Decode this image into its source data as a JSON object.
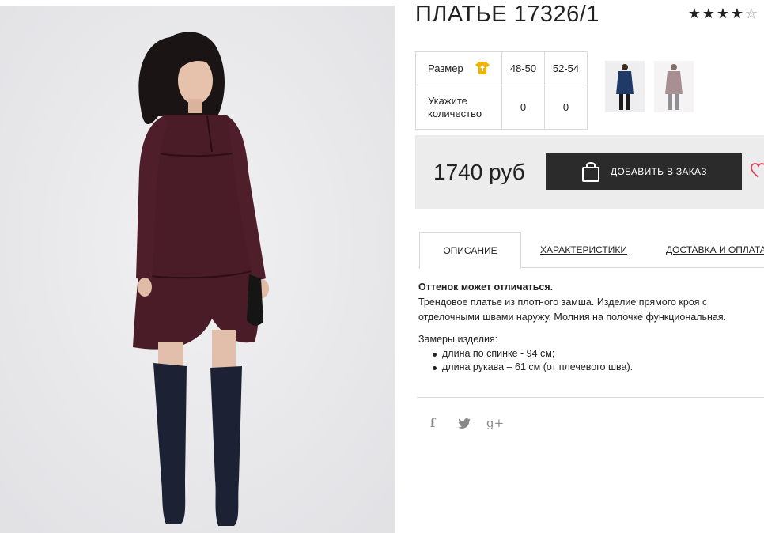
{
  "product": {
    "title": "ПЛАТЬЕ 17326/1",
    "rating": 4,
    "rating_max": 5
  },
  "sizes": {
    "size_label": "Размер",
    "qty_label_1": "Укажите",
    "qty_label_2": "количество",
    "options": [
      {
        "size": "48-50",
        "qty": "0"
      },
      {
        "size": "52-54",
        "qty": "0"
      }
    ]
  },
  "thumbnails": [
    {
      "color": "#1f3a66"
    },
    {
      "color": "#8a6a6e"
    }
  ],
  "buy": {
    "price": "1740 руб",
    "add_label": "ДОБАВИТЬ В ЗАКАЗ"
  },
  "tabs": [
    {
      "label": "ОПИСАНИЕ",
      "active": true
    },
    {
      "label": "ХАРАКТЕРИСТИКИ",
      "active": false
    },
    {
      "label": "ДОСТАВКА И ОПЛАТА",
      "active": false
    }
  ],
  "description": {
    "note": "Оттенок может отличаться.",
    "text_1": "Трендовое платье из плотного замша. Изделие прямого кроя с",
    "text_2": "отделочными швами наружу. Молния на полочке функциональная.",
    "measurements_title": "Замеры изделия:",
    "measurements": [
      "длина по спинке - 94 см;",
      "длина рукава – 61 см (от плечевого шва)."
    ]
  },
  "social": {
    "facebook": "f",
    "google_plus": "g+"
  },
  "colors": {
    "dress": "#4a1c27",
    "boots": "#1c2233",
    "button": "#2b2b2b",
    "size_icon": "#f0b400",
    "heart": "#d9435e"
  }
}
